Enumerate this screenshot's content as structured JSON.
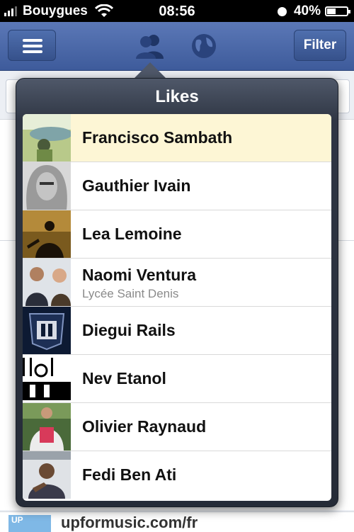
{
  "status_bar": {
    "carrier": "Bouygues",
    "time": "08:56",
    "battery": "40%"
  },
  "navbar": {
    "filter_label": "Filter"
  },
  "popover": {
    "title": "Likes",
    "items": [
      {
        "name": "Francisco Sambath",
        "subtitle": ""
      },
      {
        "name": "Gauthier Ivain",
        "subtitle": ""
      },
      {
        "name": "Lea Lemoine",
        "subtitle": ""
      },
      {
        "name": "Naomi Ventura",
        "subtitle": "Lycée Saint Denis"
      },
      {
        "name": "Diegui Rails",
        "subtitle": ""
      },
      {
        "name": "Nev Etanol",
        "subtitle": ""
      },
      {
        "name": "Olivier Raynaud",
        "subtitle": ""
      },
      {
        "name": "Fedi Ben Ati",
        "subtitle": ""
      }
    ]
  },
  "background": {
    "bottom_url": "upformusic.com/fr",
    "bottom_thumb": "UP"
  }
}
